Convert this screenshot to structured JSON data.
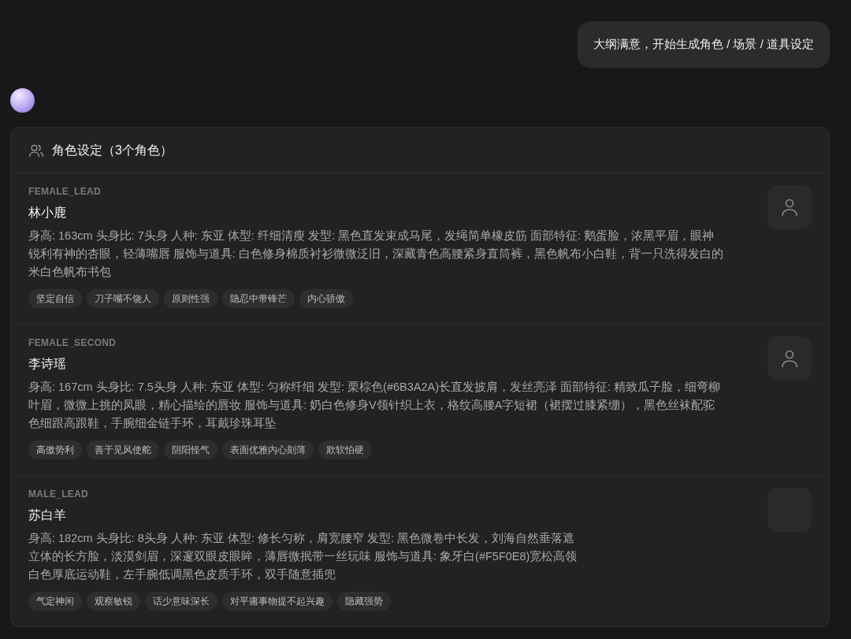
{
  "user_message": "大纲满意，开始生成角色 / 场景 / 道具设定",
  "card": {
    "title": "角色设定（3个角色）",
    "characters": [
      {
        "role": "FEMALE_LEAD",
        "name": "林小鹿",
        "avatar_icon": true,
        "description_lines": [
          "身高: 163cm 头身比: 7头身 人种: 东亚 体型: 纤细清瘦 发型: 黑色直发束成马尾，发绳简单橡皮筋 面部特征: 鹅蛋脸，浓黑平眉，眼神",
          "锐利有神的杏眼，轻薄嘴唇 服饰与道具: 白色修身棉质衬衫微微泛旧，深藏青色高腰紧身直筒裤，黑色帆布小白鞋，背一只洗得发白的",
          "米白色帆布书包"
        ],
        "tags": [
          "坚定自信",
          "刀子嘴不饶人",
          "原则性强",
          "隐忍中带锋芒",
          "内心骄傲"
        ]
      },
      {
        "role": "FEMALE_SECOND",
        "name": "李诗瑶",
        "avatar_icon": true,
        "description_lines": [
          "身高: 167cm 头身比: 7.5头身 人种: 东亚 体型: 匀称纤细 发型: 栗棕色(#6B3A2A)长直发披肩，发丝亮泽 面部特征: 精致瓜子脸，细弯柳",
          "叶眉，微微上挑的凤眼，精心描绘的唇妆 服饰与道具: 奶白色修身V领针织上衣，格纹高腰A字短裙（裙摆过膝紧绷），黑色丝袜配驼",
          "色细跟高跟鞋，手腕细金链手环，耳戴珍珠耳坠"
        ],
        "tags": [
          "高傲势利",
          "善于见风使舵",
          "阴阳怪气",
          "表面优雅内心刻薄",
          "欺软怕硬"
        ]
      },
      {
        "role": "MALE_LEAD",
        "name": "苏白羊",
        "avatar_icon": false,
        "description_lines": [
          "身高: 182cm 头身比: 8头身 人种: 东亚 体型: 修长匀称，肩宽腰窄 发型: 黑色微卷中长发，刘海自然垂落遮",
          "立体的长方脸，淡漠剑眉，深邃双眼皮眼眸，薄唇微抿带一丝玩味 服饰与道具: 象牙白(#F5F0E8)宽松高领",
          "白色厚底运动鞋，左手腕低调黑色皮质手环，双手随意插兜"
        ],
        "tags": [
          "气定神闲",
          "观察敏锐",
          "话少意味深长",
          "对平庸事物提不起兴趣",
          "隐藏强势"
        ]
      }
    ]
  }
}
